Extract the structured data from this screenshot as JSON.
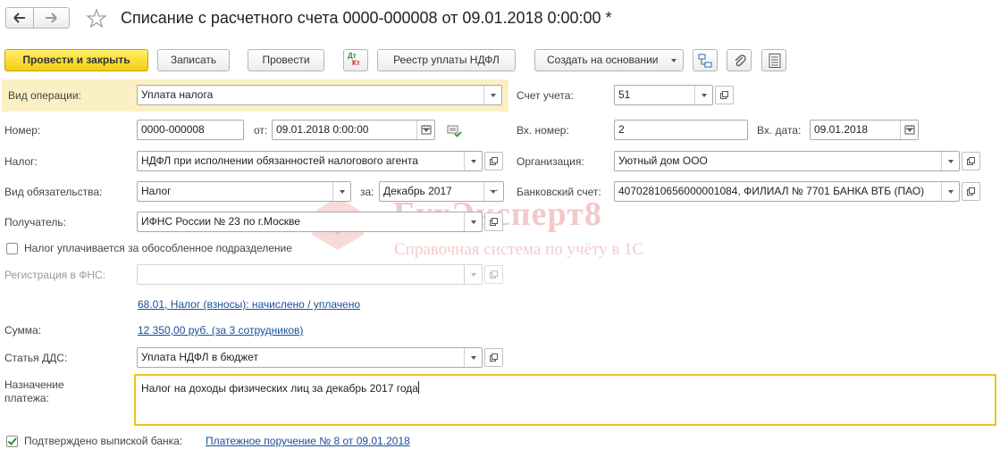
{
  "window": {
    "title": "Списание с расчетного счета 0000-000008 от 09.01.2018 0:00:00 *"
  },
  "toolbar": {
    "post_close": "Провести и закрыть",
    "save": "Записать",
    "post": "Провести",
    "dt_kt_top": "Дт",
    "dt_kt_bottom": "Кт",
    "registry": "Реестр уплаты НДФЛ",
    "create_based": "Создать на основании"
  },
  "form": {
    "operation_type_label": "Вид операции:",
    "operation_type_value": "Уплата налога",
    "account_label": "Счет учета:",
    "account_value": "51",
    "number_label": "Номер:",
    "number_value": "0000-000008",
    "from_label": "от:",
    "date_value": "09.01.2018  0:00:00",
    "incoming_number_label": "Вх. номер:",
    "incoming_number_value": "2",
    "incoming_date_label": "Вх. дата:",
    "incoming_date_value": "09.01.2018",
    "tax_label": "Налог:",
    "tax_value": "НДФЛ при исполнении обязанностей налогового агента",
    "organization_label": "Организация:",
    "organization_value": "Уютный дом ООО",
    "obligation_label": "Вид обязательства:",
    "obligation_value": "Налог",
    "for_label": "за:",
    "period_value": "Декабрь 2017",
    "period_dots": "...",
    "bank_account_label": "Банковский счет:",
    "bank_account_value": "40702810656000001084, ФИЛИАЛ № 7701 БАНКА ВТБ (ПАО)",
    "recipient_label": "Получатель:",
    "recipient_value": "ИФНС России № 23 по г.Москве",
    "separate_unit_label": "Налог уплачивается за обособленное подразделение",
    "separate_unit_checked": false,
    "fns_registration_label": "Регистрация в ФНС:",
    "fns_registration_value": "",
    "accrued_link": "68.01, Налог (взносы): начислено / уплачено",
    "amount_label": "Сумма:",
    "amount_link": "12 350,00 руб. (за 3 сотрудников)",
    "dds_label": "Статья ДДС:",
    "dds_value": "Уплата НДФЛ в бюджет",
    "purpose_label_line1": "Назначение",
    "purpose_label_line2": "платежа:",
    "purpose_value": "Налог на доходы физических лиц за декабрь 2017 года",
    "bank_confirmed_label": "Подтверждено выпиской банка:",
    "bank_confirmed_checked": true,
    "payment_order_link": "Платежное поручение № 8 от 09.01.2018"
  },
  "watermark": {
    "brand": "БухЭксперт8",
    "tagline": "Справочная система по учёту в 1С"
  },
  "colors": {
    "primary_button": "#f2cd12",
    "highlight_row": "#fbf0c4",
    "focus_border": "#f0c419",
    "link": "#1a4fa0",
    "watermark": "#f3c9c9"
  }
}
